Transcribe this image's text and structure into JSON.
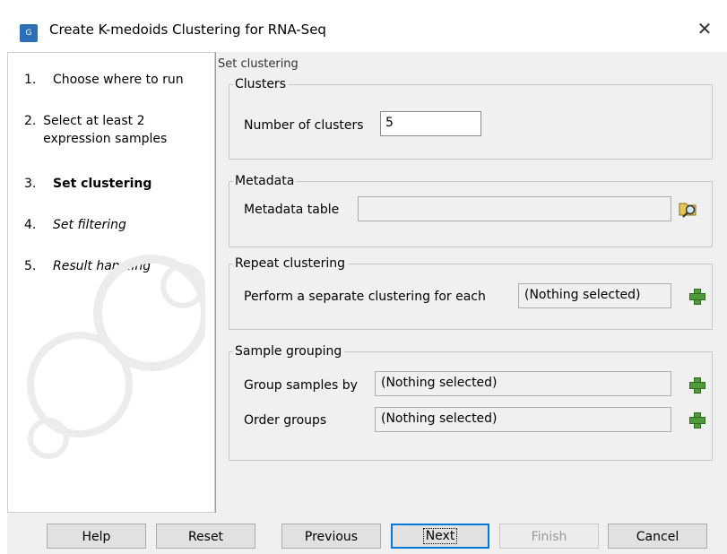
{
  "window": {
    "title": "Create K-medoids Clustering for RNA-Seq",
    "icon_text": "G",
    "close_glyph": "✕"
  },
  "steps": [
    {
      "num": "1.",
      "label": "Choose where to run",
      "state": "done"
    },
    {
      "num": "2.",
      "label": "Select at least 2 expression samples",
      "state": "done"
    },
    {
      "num": "3.",
      "label": "Set clustering",
      "state": "current"
    },
    {
      "num": "4.",
      "label": "Set filtering",
      "state": "future"
    },
    {
      "num": "5.",
      "label": "Result handling",
      "state": "future"
    }
  ],
  "main": {
    "section_title": "Set clustering",
    "clusters": {
      "legend": "Clusters",
      "number_label": "Number of clusters",
      "number_value": "5"
    },
    "metadata": {
      "legend": "Metadata",
      "table_label": "Metadata table",
      "table_value": ""
    },
    "repeat": {
      "legend": "Repeat clustering",
      "label": "Perform a separate clustering for each",
      "value": "(Nothing selected)"
    },
    "grouping": {
      "legend": "Sample grouping",
      "group_label": "Group samples by",
      "group_value": "(Nothing selected)",
      "order_label": "Order groups",
      "order_value": "(Nothing selected)"
    }
  },
  "buttons": {
    "help": "Help",
    "reset": "Reset",
    "previous": "Previous",
    "next": "Next",
    "finish": "Finish",
    "cancel": "Cancel"
  },
  "icons": {
    "add": "plus-icon",
    "browse": "browse-icon",
    "accent": "#0078d7",
    "plus_color": "#4f9a3a"
  }
}
